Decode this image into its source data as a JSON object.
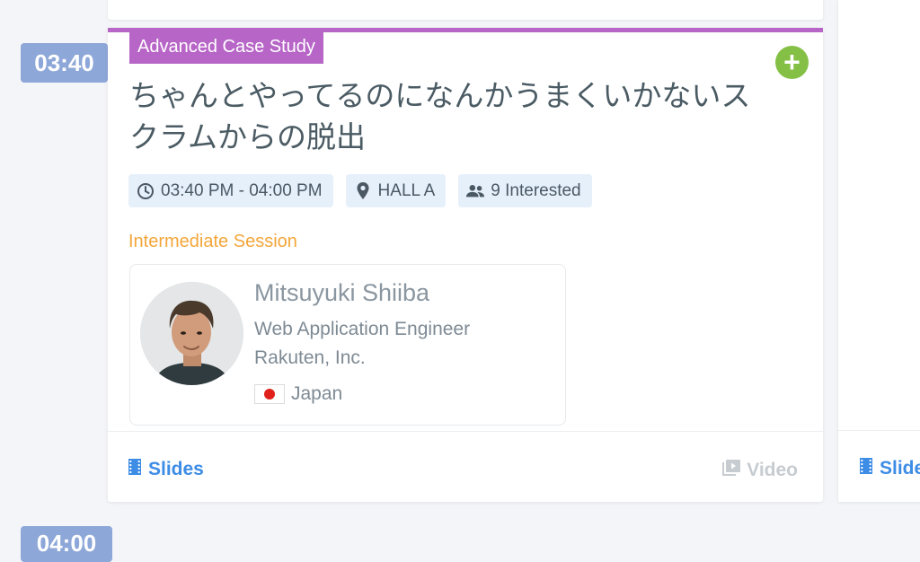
{
  "schedule": {
    "current_time": "03:40",
    "next_time": "04:00"
  },
  "session": {
    "type_label": "Advanced Case Study",
    "title": "ちゃんとやってるのになんかうまくいかないスクラムからの脱出",
    "time_range": "03:40 PM - 04:00 PM",
    "location": "HALL A",
    "interested": "9 Interested",
    "level": "Intermediate Session",
    "add_icon": "plus-icon",
    "accent_color": "#b765c7"
  },
  "speaker": {
    "name": "Mitsuyuki Shiiba",
    "role": "Web Application Engineer",
    "company": "Rakuten, Inc.",
    "country": "Japan"
  },
  "footer": {
    "slides_label": "Slides",
    "video_label": "Video"
  },
  "next_card": {
    "slides_label": "Slides"
  }
}
